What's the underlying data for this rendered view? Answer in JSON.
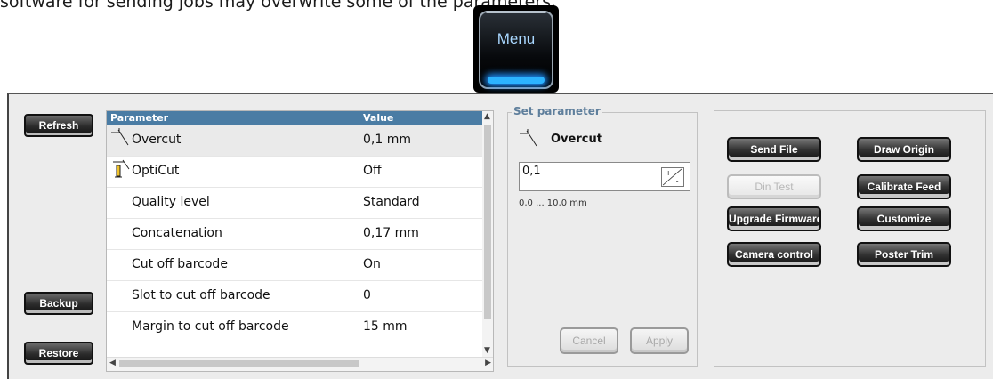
{
  "header_text": "software for sending jobs may overwrite some of the parameters.",
  "menu_button": {
    "label": "Menu"
  },
  "left_buttons": {
    "refresh": "Refresh",
    "backup": "Backup",
    "restore": "Restore"
  },
  "grid": {
    "columns": [
      "Parameter",
      "Value"
    ],
    "rows": [
      {
        "name": "Overcut",
        "value": "0,1 mm",
        "icon": "overcut-icon",
        "selected": true
      },
      {
        "name": "OptiCut",
        "value": "Off",
        "icon": "opticut-icon"
      },
      {
        "name": "Quality level",
        "value": "Standard"
      },
      {
        "name": "Concatenation",
        "value": "0,17 mm"
      },
      {
        "name": "Cut off barcode",
        "value": "On"
      },
      {
        "name": "Slot to cut off barcode",
        "value": "0"
      },
      {
        "name": "Margin to cut off barcode",
        "value": "15 mm"
      }
    ]
  },
  "set_parameter": {
    "legend": "Set parameter",
    "name": "Overcut",
    "input_value": "0,1",
    "range": "0,0 ... 10,0 mm",
    "cancel": "Cancel",
    "apply": "Apply"
  },
  "actions": {
    "send_file": "Send File",
    "draw_origin": "Draw Origin",
    "din_test": "Din Test",
    "calibrate_feed": "Calibrate Feed",
    "upgrade_firmware": "Upgrade Firmware",
    "customize": "Customize",
    "camera_control": "Camera control",
    "poster_trim": "Poster Trim"
  },
  "colors": {
    "grid_header": "#4a7ca4",
    "legend": "#5f7f9c",
    "menu_glow": "#2cb3ff"
  }
}
